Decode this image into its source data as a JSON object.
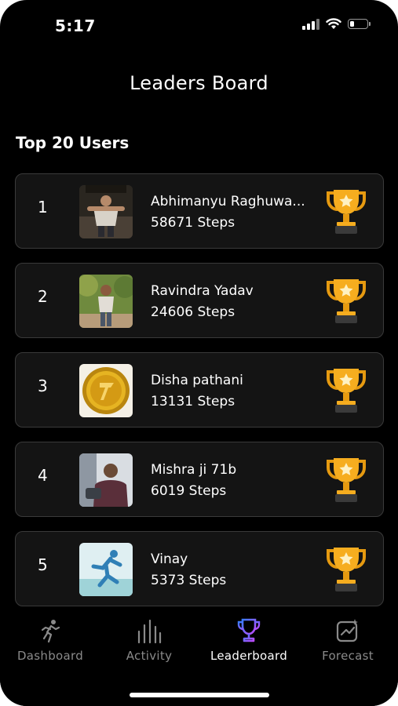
{
  "status_bar": {
    "time": "5:17",
    "battery_level": 0.25
  },
  "header": {
    "title": "Leaders Board"
  },
  "section": {
    "title": "Top 20 Users"
  },
  "leaders": [
    {
      "rank": "1",
      "name": "Abhimanyu Raghuwa...",
      "steps": "58671 Steps",
      "avatar": "avatar-photo-person",
      "trophy": "trophy-icon"
    },
    {
      "rank": "2",
      "name": "Ravindra Yadav",
      "steps": "24606 Steps",
      "avatar": "avatar-photo-person-outdoor",
      "trophy": "trophy-icon"
    },
    {
      "rank": "3",
      "name": "Disha pathani",
      "steps": "13131 Steps",
      "avatar": "avatar-gold-coin",
      "trophy": "trophy-icon"
    },
    {
      "rank": "4",
      "name": "Mishra ji 71b",
      "steps": "6019 Steps",
      "avatar": "avatar-photo-person-indoor",
      "trophy": "trophy-icon"
    },
    {
      "rank": "5",
      "name": "Vinay",
      "steps": "5373 Steps",
      "avatar": "avatar-runner",
      "trophy": "trophy-icon"
    }
  ],
  "tab_bar": {
    "tabs": [
      {
        "label": "Dashboard",
        "icon": "running-person-icon",
        "active": false
      },
      {
        "label": "Activity",
        "icon": "bar-chart-icon",
        "active": false
      },
      {
        "label": "Leaderboard",
        "icon": "trophy-icon",
        "active": true
      },
      {
        "label": "Forecast",
        "icon": "forecast-icon",
        "active": false
      }
    ]
  },
  "colors": {
    "background": "#000000",
    "card_background": "#141414",
    "card_border": "#3a3a3a",
    "trophy_gold": "#f4a81d",
    "active_tab_gradient": [
      "#3b7bff",
      "#c04bff"
    ],
    "inactive_tab": "#8a8a8a"
  }
}
